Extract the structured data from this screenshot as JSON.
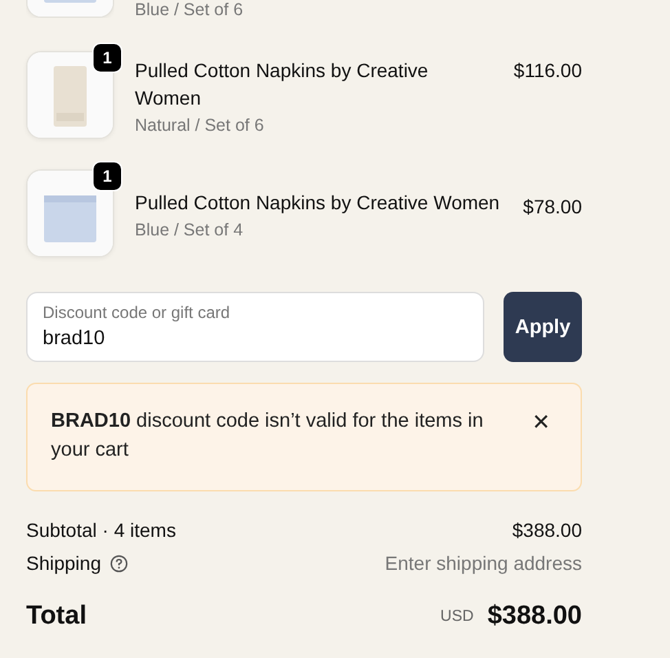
{
  "line_items": [
    {
      "variant": "Blue / Set of 6"
    },
    {
      "quantity": "1",
      "title": "Pulled Cotton Napkins by Creative Women",
      "variant": "Natural / Set of 6",
      "price": "$116.00"
    },
    {
      "quantity": "1",
      "title": "Pulled Cotton Napkins by Creative Women",
      "variant": "Blue / Set of 4",
      "price": "$78.00"
    }
  ],
  "discount": {
    "label": "Discount code or gift card",
    "value": "brad10",
    "button": "Apply"
  },
  "alert": {
    "message": "**BRAD10** discount code isn’t valid for the items in your cart",
    "close": "✕"
  },
  "summary": [
    {
      "label": "Subtotal · 4 items",
      "value": "$388.00",
      "help": false,
      "muted": false
    },
    {
      "label": "Shipping",
      "value": "Enter shipping address",
      "help": true,
      "muted": true
    }
  ],
  "total": {
    "label": "Total",
    "currency": "USD",
    "value": "$388.00"
  }
}
